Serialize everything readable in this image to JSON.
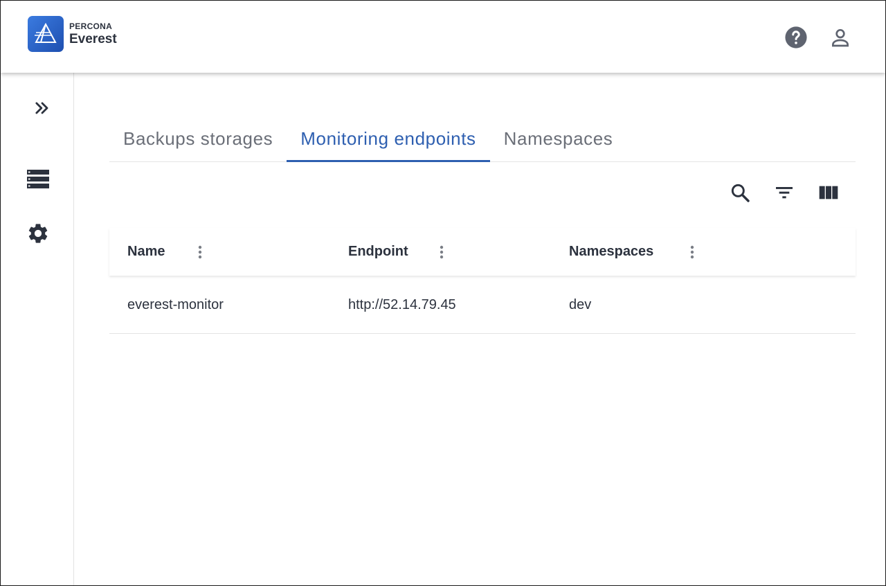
{
  "app": {
    "brand": "PERCONA",
    "product": "Everest"
  },
  "header": {
    "icons": [
      "help-icon",
      "account-icon"
    ]
  },
  "sidebar": {
    "items": [
      {
        "icon": "expand-chevrons-icon"
      },
      {
        "icon": "databases-icon"
      },
      {
        "icon": "settings-gear-icon"
      }
    ]
  },
  "tabs": [
    {
      "label": "Backups storages",
      "active": false
    },
    {
      "label": "Monitoring endpoints",
      "active": true
    },
    {
      "label": "Namespaces",
      "active": false
    }
  ],
  "toolbar": {
    "icons": [
      "search-icon",
      "filter-icon",
      "columns-icon"
    ]
  },
  "table": {
    "columns": [
      {
        "label": "Name"
      },
      {
        "label": "Endpoint"
      },
      {
        "label": "Namespaces"
      }
    ],
    "rows": [
      {
        "name": "everest-monitor",
        "endpoint": "http://52.14.79.45",
        "namespaces": "dev"
      }
    ]
  },
  "colors": {
    "accent": "#2e5fb0",
    "text": "#2c323e",
    "muted": "#6b6f78",
    "logo": "#2a63c8"
  }
}
